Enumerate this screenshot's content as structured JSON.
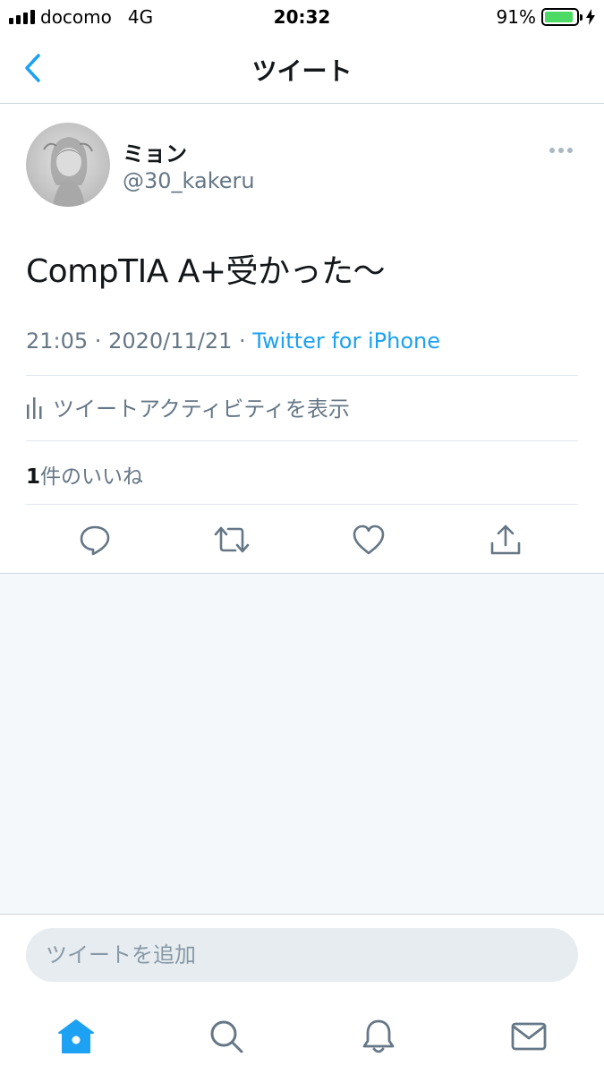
{
  "status_bar": {
    "carrier": "docomo",
    "network": "4G",
    "time": "20:32",
    "battery_percent": "91%",
    "battery_level": 0.91
  },
  "nav": {
    "title": "ツイート"
  },
  "tweet": {
    "display_name": "ミョン",
    "handle": "@30_kakeru",
    "text": "CompTIA A+受かった〜",
    "time": "21:05",
    "date": "2020/11/21",
    "separator": " · ",
    "source": "Twitter for iPhone",
    "activity_label": "ツイートアクティビティを表示",
    "likes_count": "1",
    "likes_label": "件のいいね"
  },
  "compose": {
    "placeholder": "ツイートを追加"
  },
  "colors": {
    "accent": "#1da1f2",
    "secondary_text": "#657786",
    "icon_gray": "#657786",
    "background_gray": "#f5f8fa"
  },
  "icons": {
    "actions": [
      "reply-icon",
      "retweet-icon",
      "like-icon",
      "share-icon"
    ],
    "tabs": [
      "home-icon",
      "search-icon",
      "notifications-icon",
      "messages-icon"
    ]
  }
}
